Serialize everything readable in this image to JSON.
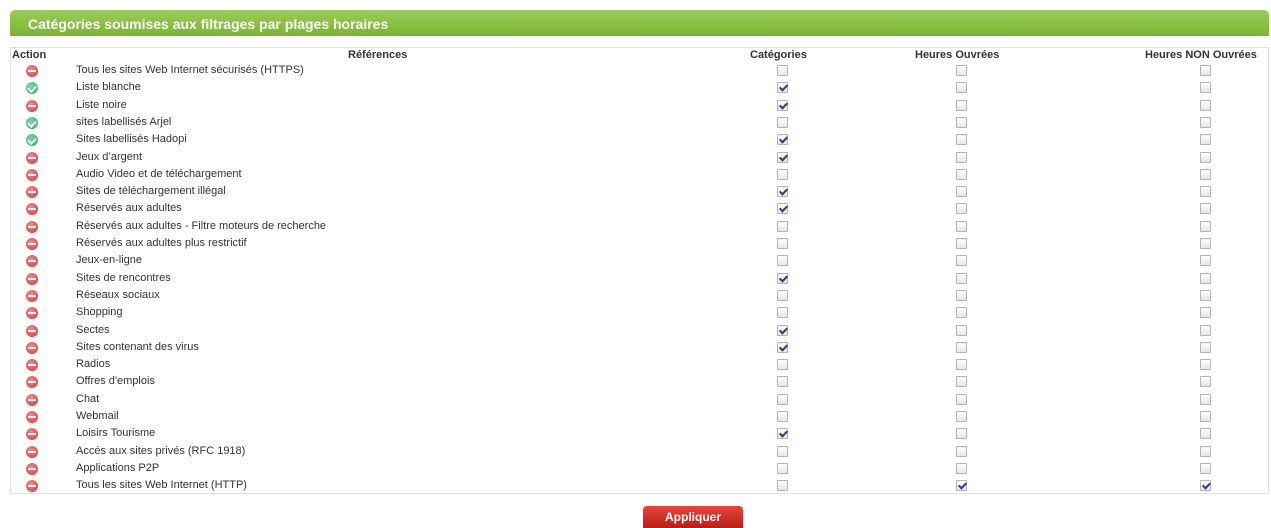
{
  "panel": {
    "title": "Catégories soumises aux filtrages par plages horaires"
  },
  "columns": {
    "action": "Action",
    "references": "Références",
    "categories": "Catégories",
    "heures_ouvrees": "Heures Ouvrées",
    "heures_non_ouvrees": "Heures NON Ouvrées"
  },
  "rows": [
    {
      "label": "Tous les sites Web Internet sécurisés (HTTPS)",
      "action": "ko",
      "categorie": false,
      "ouvrees": false,
      "non_ouvrees": false
    },
    {
      "label": "Liste blanche",
      "action": "ok",
      "categorie": true,
      "ouvrees": false,
      "non_ouvrees": false
    },
    {
      "label": "Liste noire",
      "action": "ko",
      "categorie": true,
      "ouvrees": false,
      "non_ouvrees": false
    },
    {
      "label": "sites labellisés Arjel",
      "action": "ok",
      "categorie": false,
      "ouvrees": false,
      "non_ouvrees": false
    },
    {
      "label": "Sites labellisés Hadopi",
      "action": "ok",
      "categorie": true,
      "ouvrees": false,
      "non_ouvrees": false
    },
    {
      "label": "Jeux d’argent",
      "action": "ko",
      "categorie": true,
      "ouvrees": false,
      "non_ouvrees": false
    },
    {
      "label": "Audio Video et de téléchargement",
      "action": "ko",
      "categorie": false,
      "ouvrees": false,
      "non_ouvrees": false
    },
    {
      "label": "Sites de téléchargement illégal",
      "action": "ko",
      "categorie": true,
      "ouvrees": false,
      "non_ouvrees": false
    },
    {
      "label": "Réservés aux adultes",
      "action": "ko",
      "categorie": true,
      "ouvrees": false,
      "non_ouvrees": false
    },
    {
      "label": "Réservés aux adultes - Filtre moteurs de recherche",
      "action": "ko",
      "categorie": false,
      "ouvrees": false,
      "non_ouvrees": false
    },
    {
      "label": "Réservés aux adultes plus restrictif",
      "action": "ko",
      "categorie": false,
      "ouvrees": false,
      "non_ouvrees": false
    },
    {
      "label": "Jeux-en-ligne",
      "action": "ko",
      "categorie": false,
      "ouvrees": false,
      "non_ouvrees": false
    },
    {
      "label": "Sites de rencontres",
      "action": "ko",
      "categorie": true,
      "ouvrees": false,
      "non_ouvrees": false
    },
    {
      "label": "Réseaux sociaux",
      "action": "ko",
      "categorie": false,
      "ouvrees": false,
      "non_ouvrees": false
    },
    {
      "label": "Shopping",
      "action": "ko",
      "categorie": false,
      "ouvrees": false,
      "non_ouvrees": false
    },
    {
      "label": "Sectes",
      "action": "ko",
      "categorie": true,
      "ouvrees": false,
      "non_ouvrees": false
    },
    {
      "label": "Sites contenant des virus",
      "action": "ko",
      "categorie": true,
      "ouvrees": false,
      "non_ouvrees": false
    },
    {
      "label": "Radios",
      "action": "ko",
      "categorie": false,
      "ouvrees": false,
      "non_ouvrees": false
    },
    {
      "label": "Offres d'emplois",
      "action": "ko",
      "categorie": false,
      "ouvrees": false,
      "non_ouvrees": false
    },
    {
      "label": "Chat",
      "action": "ko",
      "categorie": false,
      "ouvrees": false,
      "non_ouvrees": false
    },
    {
      "label": "Webmail",
      "action": "ko",
      "categorie": false,
      "ouvrees": false,
      "non_ouvrees": false
    },
    {
      "label": "Loisirs Tourisme",
      "action": "ko",
      "categorie": true,
      "ouvrees": false,
      "non_ouvrees": false
    },
    {
      "label": "Accés aux sites privés (RFC 1918)",
      "action": "ko",
      "categorie": false,
      "ouvrees": false,
      "non_ouvrees": false
    },
    {
      "label": "Applications P2P",
      "action": "ko",
      "categorie": false,
      "ouvrees": false,
      "non_ouvrees": false
    },
    {
      "label": "Tous les sites Web Internet (HTTP)",
      "action": "ko",
      "categorie": false,
      "ouvrees": true,
      "non_ouvrees": true
    }
  ],
  "apply_button": {
    "label": "Appliquer"
  },
  "icons": {
    "ok": "green-check-circle-icon",
    "ko": "red-minus-circle-icon"
  },
  "colors": {
    "header_green": "#79b530",
    "button_red": "#d9342a",
    "ok_green": "#2fa765",
    "ko_red": "#d9343a"
  }
}
